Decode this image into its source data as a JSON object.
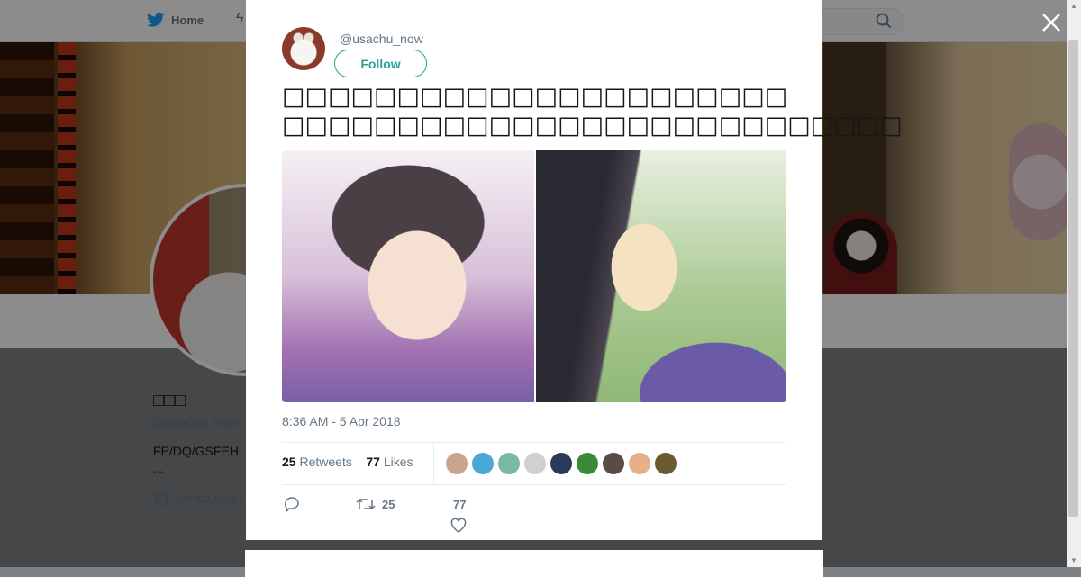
{
  "nav": {
    "home_label": "Home"
  },
  "profile": {
    "name": "□□□",
    "handle": "@usachu_now",
    "bio": "FE/DQ/GSFEH",
    "bio_more": "...",
    "joined": "Joined Augu"
  },
  "tweet": {
    "handle": "@usachu_now",
    "follow_label": "Follow",
    "text_line1": "□□□□□□□□□□□□□□□□□□□□□□",
    "text_line2": "□□□□□□□□□□□□□□□□□□□□□□□□□□□",
    "time": "8:36 AM - 5 Apr 2018",
    "retweets_count": "25",
    "retweets_label": "Retweets",
    "likes_count": "77",
    "likes_label": "Likes",
    "action_retweet_count": "25",
    "action_like_count": "77",
    "liker_colors": [
      "#c9a58f",
      "#4aa8d8",
      "#7bb8a0",
      "#d0d0d0",
      "#2a3a5a",
      "#3a8a3a",
      "#5a4a48",
      "#e8b088",
      "#6a5a30"
    ]
  },
  "icons": [
    "twitter-bird-icon",
    "lightning-icon",
    "search-icon",
    "close-icon",
    "calendar-icon",
    "reply-icon",
    "retweet-icon",
    "heart-icon"
  ]
}
